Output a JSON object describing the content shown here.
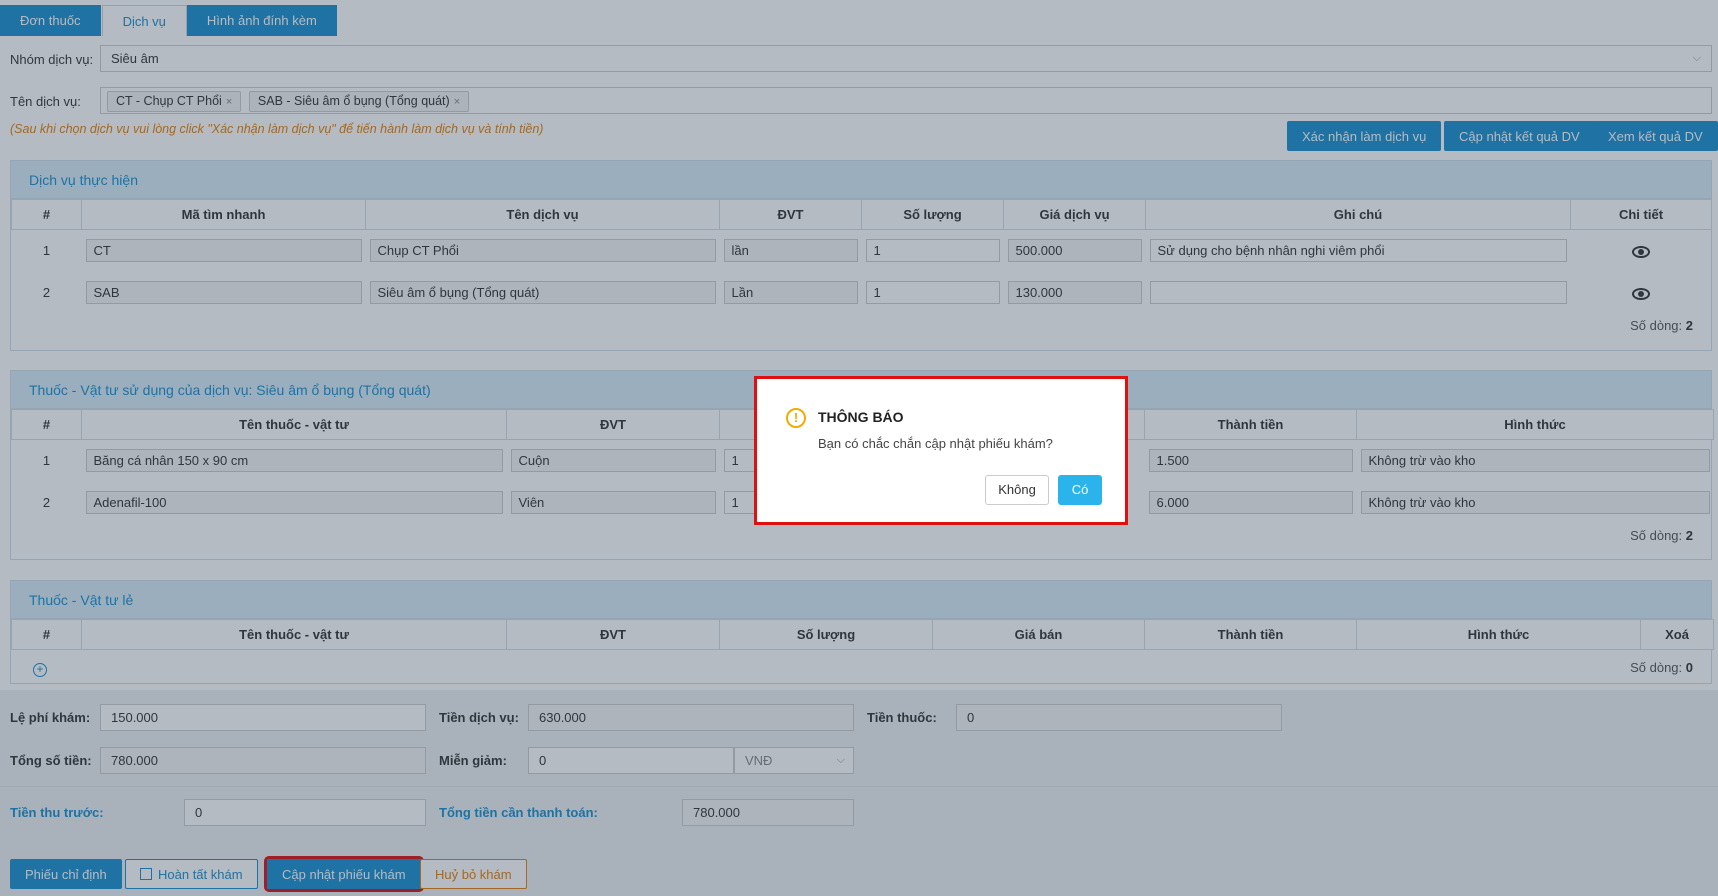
{
  "tabs": [
    {
      "label": "Đơn thuốc"
    },
    {
      "label": "Dịch vụ"
    },
    {
      "label": "Hình ảnh đính kèm"
    }
  ],
  "form": {
    "service_group_label": "Nhóm dịch vụ:",
    "service_group_value": "Siêu âm",
    "service_name_label": "Tên dịch vụ:",
    "service_tags": [
      "CT - Chụp CT Phổi",
      "SAB - Siêu âm ổ bụng (Tổng quát)"
    ],
    "note": "(Sau khi chọn dịch vụ vui lòng click \"Xác nhận làm dịch vụ\" để tiến hành làm dịch vụ và tính tiền)"
  },
  "actions": {
    "confirm": "Xác nhận làm dịch vụ",
    "update_result": "Cập nhật kết quả DV",
    "view_result": "Xem kết quả DV"
  },
  "services_panel": {
    "title": "Dịch vụ thực hiện",
    "headers": [
      "#",
      "Mã tìm nhanh",
      "Tên dịch vụ",
      "ĐVT",
      "Số lượng",
      "Giá dịch vụ",
      "Ghi chú",
      "Chi tiết"
    ],
    "rows": [
      {
        "idx": "1",
        "code": "CT",
        "name": "Chụp CT Phổi",
        "unit": "lần",
        "qty": "1",
        "price": "500.000",
        "note": "Sử dụng cho bệnh nhân nghi viêm phổi"
      },
      {
        "idx": "2",
        "code": "SAB",
        "name": "Siêu âm ổ bụng (Tổng quát)",
        "unit": "Lần",
        "qty": "1",
        "price": "130.000",
        "note": ""
      }
    ],
    "row_count_label": "Số dòng:",
    "row_count": "2"
  },
  "supplies_panel": {
    "title": "Thuốc - Vật tư sử dụng của dịch vụ: Siêu âm ổ bụng (Tổng quát)",
    "headers": [
      "#",
      "Tên thuốc - vật tư",
      "ĐVT",
      "",
      "",
      "Thành tiền",
      "Hình thức"
    ],
    "rows": [
      {
        "idx": "1",
        "name": "Băng cá nhân 150 x 90 cm",
        "unit": "Cuộn",
        "qty": "1",
        "total": "1.500",
        "type": "Không trừ vào kho"
      },
      {
        "idx": "2",
        "name": "Adenafil-100",
        "unit": "Viên",
        "qty": "1",
        "total": "6.000",
        "type": "Không trừ vào kho"
      }
    ],
    "row_count_label": "Số dòng:",
    "row_count": "2"
  },
  "retail_panel": {
    "title": "Thuốc - Vật tư lẻ",
    "headers": [
      "#",
      "Tên thuốc - vật tư",
      "ĐVT",
      "Số lượng",
      "Giá bán",
      "Thành tiền",
      "Hình thức",
      "Xoá"
    ],
    "row_count_label": "Số dòng:",
    "row_count": "0"
  },
  "totals": {
    "exam_fee_label": "Lệ phí khám:",
    "exam_fee": "150.000",
    "service_fee_label": "Tiền dịch vụ:",
    "service_fee": "630.000",
    "drug_fee_label": "Tiền thuốc:",
    "drug_fee": "0",
    "grand_total_label": "Tổng số tiền:",
    "grand_total": "780.000",
    "discount_label": "Miễn giảm:",
    "discount": "0",
    "currency": "VNĐ",
    "prepaid_label": "Tiền thu trước:",
    "prepaid": "0",
    "to_pay_label": "Tổng tiền cần thanh toán:",
    "to_pay": "780.000"
  },
  "bottom": {
    "order_sheet": "Phiếu chỉ định",
    "complete": "Hoàn tất khám",
    "update": "Cập nhật phiếu khám",
    "cancel": "Huỷ bỏ khám"
  },
  "dialog": {
    "title": "THÔNG BÁO",
    "message": "Bạn có chắc chắn cập nhật phiếu khám?",
    "no": "Không",
    "yes": "Có"
  }
}
